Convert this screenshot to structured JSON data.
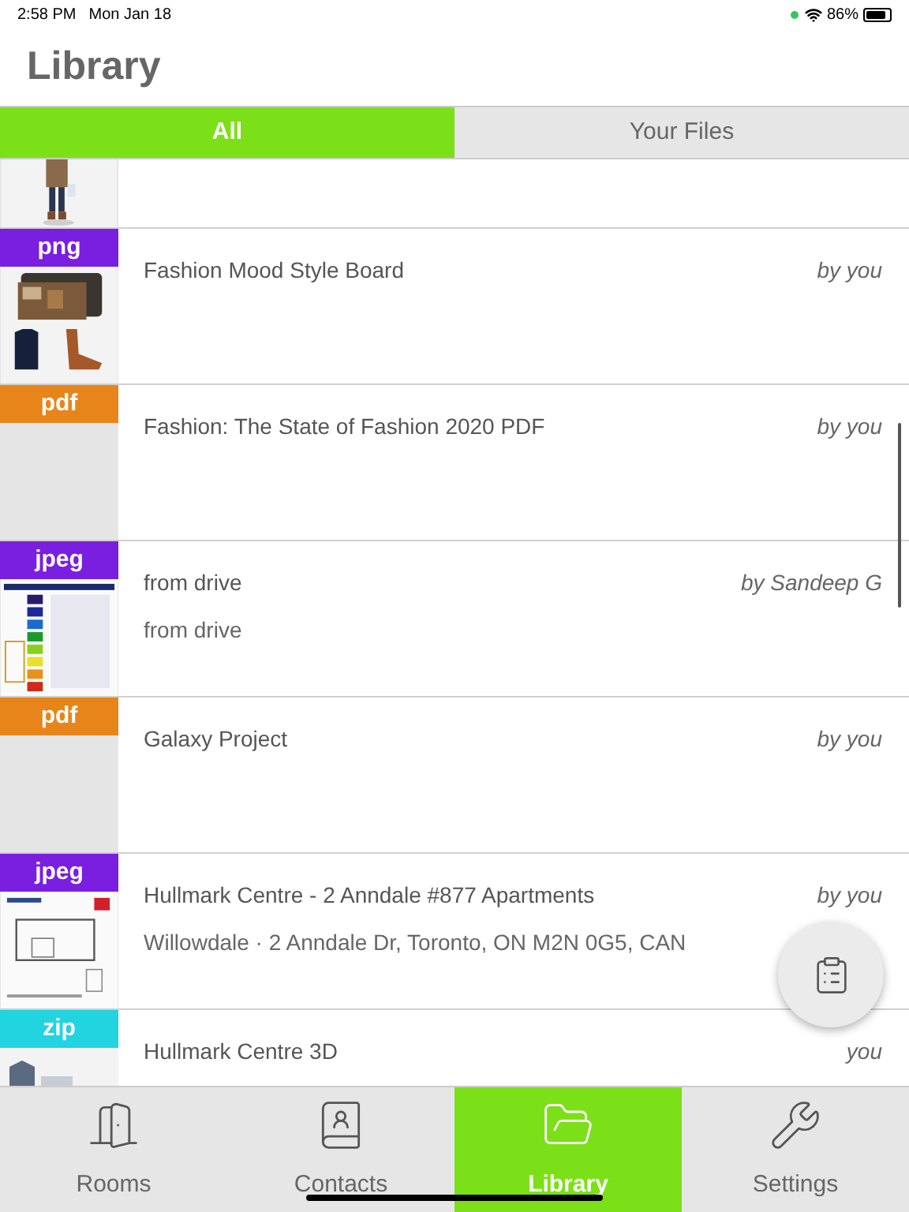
{
  "status_bar": {
    "time": "2:58 PM",
    "date": "Mon Jan 18",
    "battery": "86%"
  },
  "header": {
    "title": "Library"
  },
  "tabs": [
    {
      "label": "All",
      "selected": true
    },
    {
      "label": "Your Files",
      "selected": false
    }
  ],
  "files": [
    {
      "kind": "picture"
    },
    {
      "type": "png",
      "color": "#7a1fe0",
      "kind": "picture",
      "title": "Fashion Mood Style Board",
      "author": "by you"
    },
    {
      "type": "pdf",
      "color": "#e8851a",
      "title": "Fashion: The State of Fashion 2020 PDF",
      "author": "by you"
    },
    {
      "type": "jpeg",
      "color": "#7a1fe0",
      "kind": "picture",
      "title": "from drive",
      "subtitle": "from drive",
      "author": "by Sandeep G"
    },
    {
      "type": "pdf",
      "color": "#e8851a",
      "title": "Galaxy Project",
      "author": "by you"
    },
    {
      "type": "jpeg",
      "color": "#7a1fe0",
      "kind": "picture",
      "title": "Hullmark Centre - 2 Anndale #877 Apartments",
      "subtitle": "Willowdale · 2 Anndale Dr, Toronto, ON M2N 0G5, CAN",
      "author": "by you"
    },
    {
      "type": "zip",
      "color": "#22d3e0",
      "kind": "picture",
      "title": "Hullmark Centre 3D",
      "author": "you"
    }
  ],
  "nav": [
    {
      "label": "Rooms",
      "selected": false
    },
    {
      "label": "Contacts",
      "selected": false
    },
    {
      "label": "Library",
      "selected": true
    },
    {
      "label": "Settings",
      "selected": false
    }
  ]
}
